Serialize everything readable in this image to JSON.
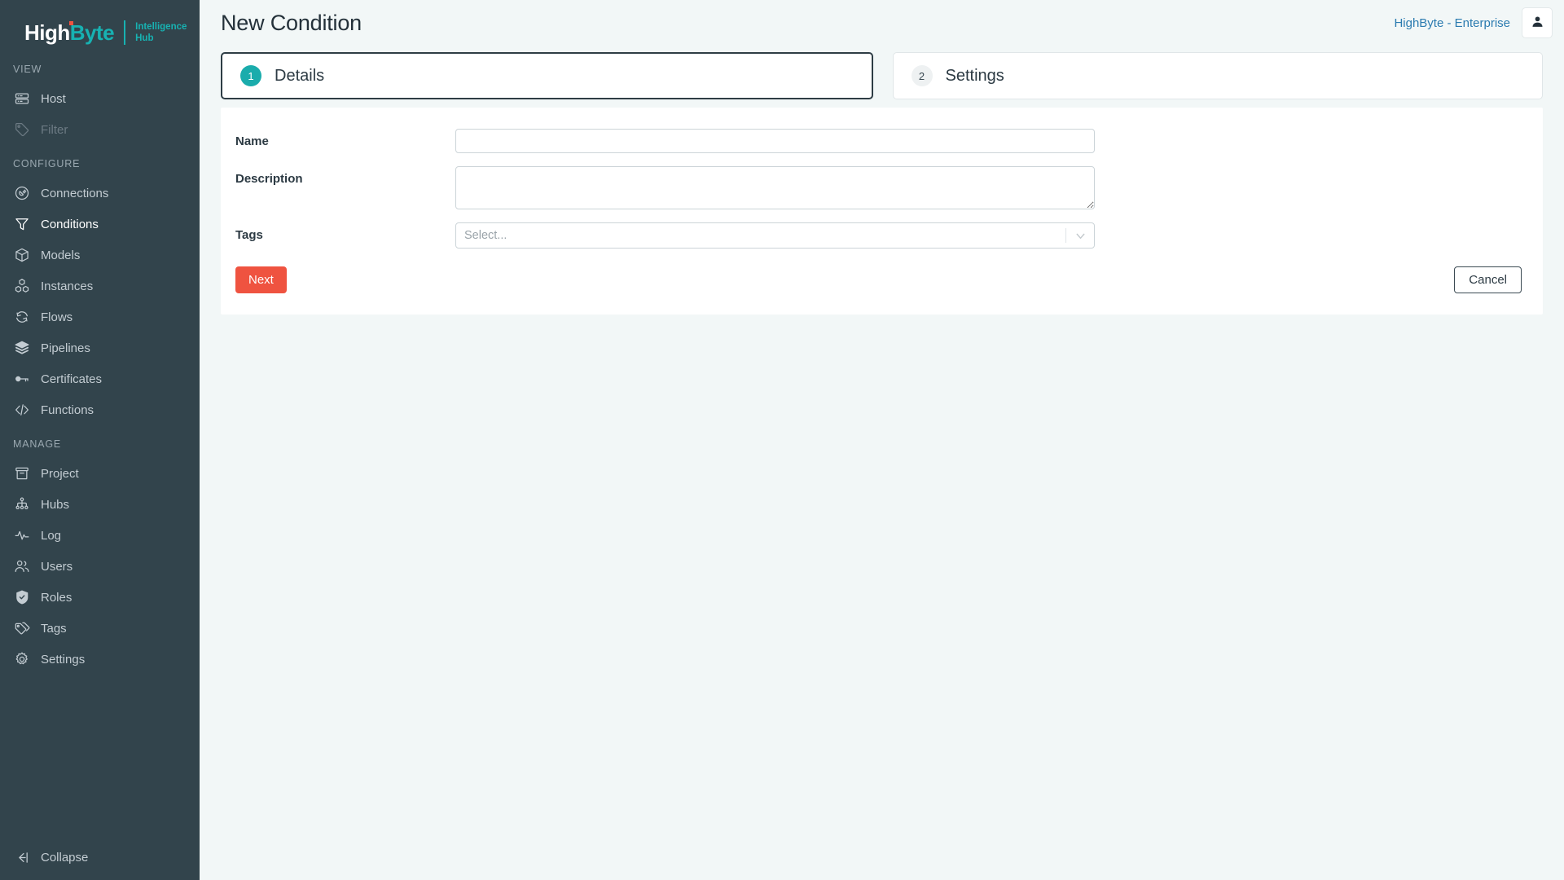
{
  "brand": {
    "logo_primary": "High",
    "logo_accent": "Byte",
    "logo_sub_line1": "Intelligence",
    "logo_sub_line2": "Hub",
    "accent_teal": "#17b2b2",
    "accent_red": "#ef5340",
    "sidebar_bg": "#32444c"
  },
  "sidebar": {
    "sections": [
      {
        "title": "VIEW",
        "items": [
          {
            "label": "Host",
            "icon": "server-icon",
            "state": "normal"
          },
          {
            "label": "Filter",
            "icon": "tag-icon",
            "state": "disabled"
          }
        ]
      },
      {
        "title": "CONFIGURE",
        "items": [
          {
            "label": "Connections",
            "icon": "plug-circle-icon",
            "state": "normal"
          },
          {
            "label": "Conditions",
            "icon": "funnel-icon",
            "state": "active"
          },
          {
            "label": "Models",
            "icon": "box-icon",
            "state": "normal"
          },
          {
            "label": "Instances",
            "icon": "cubes-icon",
            "state": "normal"
          },
          {
            "label": "Flows",
            "icon": "refresh-circle-icon",
            "state": "normal"
          },
          {
            "label": "Pipelines",
            "icon": "layers-icon",
            "state": "normal"
          },
          {
            "label": "Certificates",
            "icon": "key-icon",
            "state": "normal"
          },
          {
            "label": "Functions",
            "icon": "code-brackets-icon",
            "state": "normal"
          }
        ]
      },
      {
        "title": "MANAGE",
        "items": [
          {
            "label": "Project",
            "icon": "archive-box-icon",
            "state": "normal"
          },
          {
            "label": "Hubs",
            "icon": "sitemap-icon",
            "state": "normal"
          },
          {
            "label": "Log",
            "icon": "activity-pulse-icon",
            "state": "normal"
          },
          {
            "label": "Users",
            "icon": "users-icon",
            "state": "normal"
          },
          {
            "label": "Roles",
            "icon": "shield-check-icon",
            "state": "normal"
          },
          {
            "label": "Tags",
            "icon": "tags-icon",
            "state": "normal"
          },
          {
            "label": "Settings",
            "icon": "gear-icon",
            "state": "normal"
          }
        ]
      }
    ],
    "collapse_label": "Collapse",
    "collapse_icon": "arrow-left-to-bar-icon"
  },
  "topbar": {
    "title": "New Condition",
    "enterprise_label": "HighByte - Enterprise",
    "avatar_icon": "user-icon"
  },
  "steps": [
    {
      "number": "1",
      "label": "Details",
      "state": "active"
    },
    {
      "number": "2",
      "label": "Settings",
      "state": "inactive"
    }
  ],
  "form": {
    "fields": [
      {
        "label": "Name",
        "type": "text",
        "value": "",
        "placeholder": ""
      },
      {
        "label": "Description",
        "type": "textarea",
        "value": "",
        "placeholder": ""
      },
      {
        "label": "Tags",
        "type": "select",
        "value": "",
        "placeholder": "Select..."
      }
    ]
  },
  "actions": {
    "next_label": "Next",
    "cancel_label": "Cancel"
  }
}
